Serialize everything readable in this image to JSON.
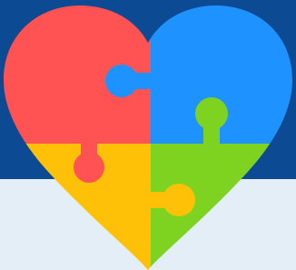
{
  "colors": {
    "background_top": "#0C4A94",
    "background_bottom": "#E3EEF6",
    "piece_top_left": "#FF5252",
    "piece_top_right": "#1E93FF",
    "piece_bottom_left": "#FFC107",
    "piece_bottom_right": "#7ED321"
  }
}
